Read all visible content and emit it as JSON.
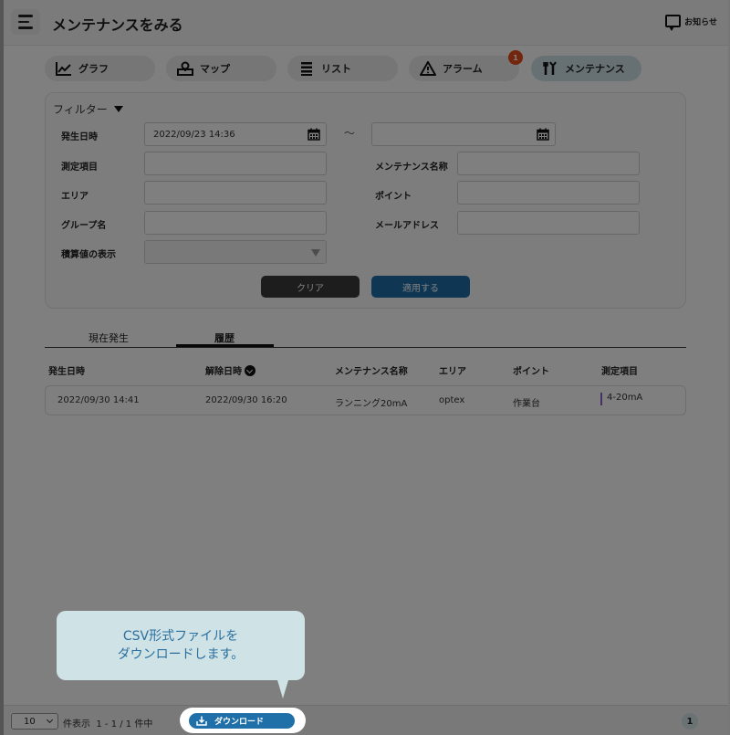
{
  "header": {
    "title": "メンテナンスをみる",
    "notice_label": "お知らせ"
  },
  "nav_tabs": [
    {
      "label": "グラフ",
      "icon": "chart-line-icon",
      "active": false
    },
    {
      "label": "マップ",
      "icon": "map-pin-icon",
      "active": false
    },
    {
      "label": "リスト",
      "icon": "list-icon",
      "active": false
    },
    {
      "label": "アラーム",
      "icon": "warning-icon",
      "active": false,
      "badge": "1"
    },
    {
      "label": "メンテナンス",
      "icon": "tools-icon",
      "active": true
    }
  ],
  "filter": {
    "title": "フィルター",
    "occurred_label": "発生日時",
    "occurred_from": "2022/09/23 14:36",
    "occurred_to": "",
    "range_sep": "～",
    "measure_label": "測定項目",
    "maint_name_label": "メンテナンス名称",
    "area_label": "エリア",
    "point_label": "ポイント",
    "group_label": "グループ名",
    "mail_label": "メールアドレス",
    "cumulative_label": "積算値の表示",
    "clear_label": "クリア",
    "apply_label": "適用する"
  },
  "sub_tabs": [
    {
      "label": "現在発生",
      "active": false
    },
    {
      "label": "履歴",
      "active": true
    }
  ],
  "table": {
    "columns": [
      "発生日時",
      "解除日時",
      "メンテナンス名称",
      "エリア",
      "ポイント",
      "測定項目"
    ],
    "rows": [
      [
        "2022/09/30 14:41",
        "2022/09/30 16:20",
        "ランニング20mA",
        "optex",
        "作業台",
        "4-20mA"
      ]
    ]
  },
  "footer": {
    "per_page": "10",
    "per_page_label": "件表示",
    "range_text": "1 - 1 / 1 件中",
    "download_label": "ダウンロード",
    "current_page": "1"
  },
  "tooltip": {
    "line1": "CSV形式ファイルを",
    "line2": "ダウンロードします。"
  },
  "colors": {
    "accent": "#1f6fa8",
    "badge": "#e84a1a",
    "active_tab": "#cfe2e6",
    "measure_bar": "#8a5fc7"
  }
}
